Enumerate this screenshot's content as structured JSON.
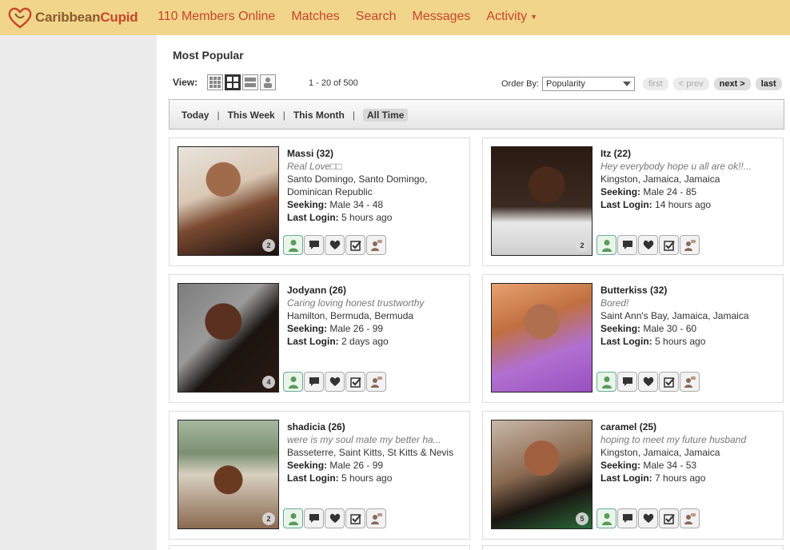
{
  "brand": {
    "part1": "Caribbean",
    "part2": "Cupid"
  },
  "nav": {
    "members_online": "110 Members Online",
    "matches": "Matches",
    "search": "Search",
    "messages": "Messages",
    "activity": "Activity"
  },
  "page": {
    "title": "Most Popular",
    "view_label": "View:",
    "range": "1 - 20 of 500",
    "order_by_label": "Order By:",
    "order_by_value": "Popularity",
    "pager": {
      "first": "first",
      "prev": "< prev",
      "next": "next >",
      "last": "last"
    }
  },
  "filters": {
    "today": "Today",
    "week": "This Week",
    "month": "This Month",
    "all": "All Time"
  },
  "labels": {
    "seeking": "Seeking:",
    "last_login": "Last Login:"
  },
  "profiles": [
    {
      "name": "Massi (32)",
      "tagline": "Real Love□□",
      "location": "Santo Domingo, Santo Domingo, Dominican Republic",
      "seeking": "Male 34 - 48",
      "last_login": "5 hours ago",
      "photos": "2"
    },
    {
      "name": "Itz (22)",
      "tagline": "Hey everybody hope u all are ok!!...",
      "location": "Kingston, Jamaica, Jamaica",
      "seeking": "Male 24 - 85",
      "last_login": "14 hours ago",
      "photos": "2"
    },
    {
      "name": "Jodyann (26)",
      "tagline": "Caring loving honest trustworthy",
      "location": "Hamilton, Bermuda, Bermuda",
      "seeking": "Male 26 - 99",
      "last_login": "2 days ago",
      "photos": "4"
    },
    {
      "name": "Butterkiss (32)",
      "tagline": "Bored!",
      "location": "Saint Ann's Bay, Jamaica, Jamaica",
      "seeking": "Male 30 - 60",
      "last_login": "5 hours ago",
      "photos": ""
    },
    {
      "name": "shadicia (26)",
      "tagline": "were is my soul mate my better ha...",
      "location": "Basseterre, Saint Kitts, St Kitts & Nevis",
      "seeking": "Male 26 - 99",
      "last_login": "5 hours ago",
      "photos": "2"
    },
    {
      "name": "caramel (25)",
      "tagline": "hoping to meet my future husband",
      "location": "Kingston, Jamaica, Jamaica",
      "seeking": "Male 34 - 53",
      "last_login": "7 hours ago",
      "photos": "5"
    }
  ],
  "colors": {
    "topbar": "#f1d58a",
    "nav_text": "#c7462a",
    "left_panel": "#ececec"
  }
}
